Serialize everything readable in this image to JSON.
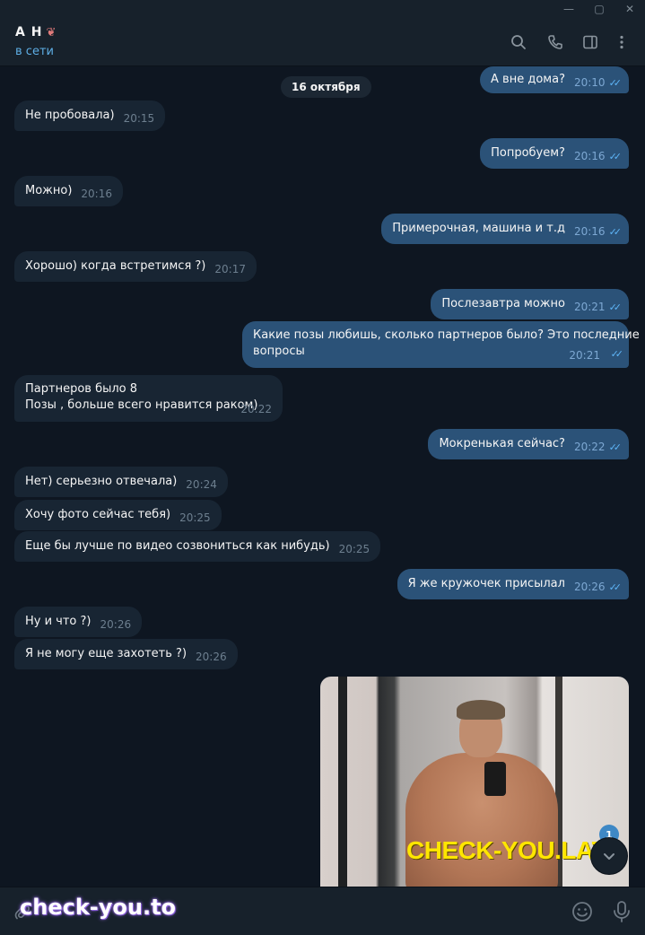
{
  "window": {
    "minimize": "—",
    "maximize": "▢",
    "close": "✕"
  },
  "header": {
    "name": "А Н",
    "name_emoji": "❦",
    "status": "в сети",
    "icons": [
      "search-icon",
      "phone-icon",
      "sidebar-toggle-icon",
      "more-vertical-icon"
    ]
  },
  "date_separator": "16 октября",
  "messages": [
    {
      "dir": "out",
      "text": "А вне дома?",
      "time": "20:10",
      "read": true
    },
    {
      "dir": "in",
      "text": "Не пробовала)",
      "time": "20:15"
    },
    {
      "dir": "out",
      "text": "Попробуем?",
      "time": "20:16",
      "read": true
    },
    {
      "dir": "in",
      "text": "Можно)",
      "time": "20:16"
    },
    {
      "dir": "out",
      "text": "Примерочная, машина и т.д",
      "time": "20:16",
      "read": true
    },
    {
      "dir": "in",
      "text": "Хорошо) когда встретимся ?)",
      "time": "20:17"
    },
    {
      "dir": "out",
      "text": "Послезавтра можно",
      "time": "20:21",
      "read": true
    },
    {
      "dir": "out",
      "line1": "Какие позы любишь, сколько партнеров было? Это последние",
      "line2": "вопросы",
      "time": "20:21",
      "read": true
    },
    {
      "dir": "in",
      "line1": "Партнеров было 8",
      "line2": "Позы , больше всего нравится раком)",
      "time": "20:22"
    },
    {
      "dir": "out",
      "text": "Мокренькая сейчас?",
      "time": "20:22",
      "read": true
    },
    {
      "dir": "in",
      "text": "Нет) серьезно отвечала)",
      "time": "20:24"
    },
    {
      "dir": "in",
      "text": "Хочу фото сейчас тебя)",
      "time": "20:25"
    },
    {
      "dir": "in",
      "text": "Еще бы лучше по видео созвониться как нибудь)",
      "time": "20:25"
    },
    {
      "dir": "out",
      "text": "Я же кружочек присылал",
      "time": "20:26",
      "read": true
    },
    {
      "dir": "in",
      "text": "Ну и что ?)",
      "time": "20:26"
    },
    {
      "dir": "in",
      "text": "Я не могу еще захотеть ?)",
      "time": "20:26"
    }
  ],
  "read_ticks": "✓✓",
  "photo_watermark": "CHECK-YOU.LAT",
  "scroll": {
    "unread_count": "1",
    "arrow": "⌄"
  },
  "composer": {
    "watermark": "check-you.to",
    "placeholder": ""
  },
  "colors": {
    "background": "#0e1621",
    "header": "#17212b",
    "incoming_bubble": "#182533",
    "outgoing_bubble": "#2b5278",
    "accent": "#5eaee5",
    "watermark_yellow": "#ffe600"
  }
}
